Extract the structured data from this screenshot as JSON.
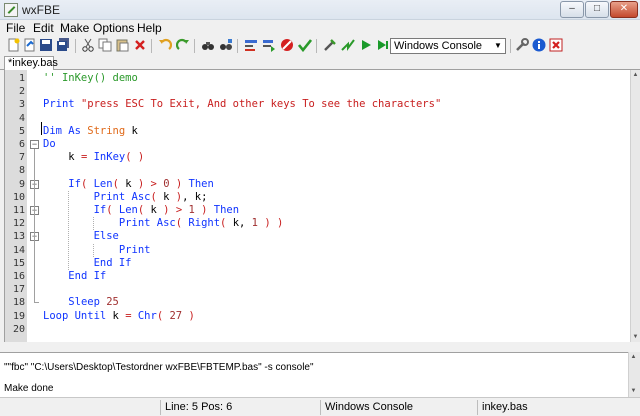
{
  "window": {
    "title": "wxFBE",
    "min_label": "–",
    "max_label": "□",
    "close_label": "✕"
  },
  "menu": [
    "File",
    "Edit",
    "Make",
    "Options",
    "Help"
  ],
  "toolbar": {
    "icons": [
      "new-file-icon",
      "open-file-icon",
      "save-icon",
      "save-all-icon",
      "cut-icon",
      "copy-icon",
      "paste-icon",
      "delete-icon",
      "undo-icon",
      "redo-icon",
      "find-icon",
      "replace-icon",
      "compile-icon",
      "compile-run-icon",
      "stop-icon",
      "check-icon",
      "build-icon",
      "quick-run-icon",
      "run-icon",
      "run-terminal-icon",
      "settings-icon",
      "info-icon",
      "close-icon"
    ],
    "target_select": "Windows Console"
  },
  "tab": {
    "label": "*inkey.bas"
  },
  "editor": {
    "lines": [
      {
        "n": "1",
        "html": "<span class='cm'>'' InKey() demo</span>"
      },
      {
        "n": "2",
        "html": ""
      },
      {
        "n": "3",
        "html": "<span class='kw'>Print</span> <span class='st'>\"press ESC To Exit, And other keys To see the characters\"</span>"
      },
      {
        "n": "4",
        "html": ""
      },
      {
        "n": "5",
        "html": "<span class='kw'>Dim As</span> <span class='ty'>String</span> <span class='id'>k</span>"
      },
      {
        "n": "6",
        "html": "<span class='kw'>Do</span>"
      },
      {
        "n": "7",
        "html": "    <span class='id'>k</span> <span class='op'>=</span> <span class='kw'>InKey</span><span class='op'>( )</span>"
      },
      {
        "n": "8",
        "html": ""
      },
      {
        "n": "9",
        "html": "    <span class='kw'>If</span><span class='op'>(</span> <span class='kw'>Len</span><span class='op'>(</span> <span class='id'>k</span> <span class='op'>) &gt;</span> <span class='nm'>0</span> <span class='op'>)</span> <span class='kw'>Then</span>"
      },
      {
        "n": "10",
        "html": "        <span class='kw'>Print Asc</span><span class='op'>(</span> <span class='id'>k</span> <span class='op'>)</span>, <span class='id'>k</span>;"
      },
      {
        "n": "11",
        "html": "        <span class='kw'>If</span><span class='op'>(</span> <span class='kw'>Len</span><span class='op'>(</span> <span class='id'>k</span> <span class='op'>) &gt;</span> <span class='nm'>1</span> <span class='op'>)</span> <span class='kw'>Then</span>"
      },
      {
        "n": "12",
        "html": "            <span class='kw'>Print Asc</span><span class='op'>(</span> <span class='kw'>Right</span><span class='op'>(</span> <span class='id'>k</span>, <span class='nm'>1</span> <span class='op'>) )</span>"
      },
      {
        "n": "13",
        "html": "        <span class='kw'>Else</span>"
      },
      {
        "n": "14",
        "html": "            <span class='kw'>Print</span>"
      },
      {
        "n": "15",
        "html": "        <span class='kw'>End If</span>"
      },
      {
        "n": "16",
        "html": "    <span class='kw'>End If</span>"
      },
      {
        "n": "17",
        "html": ""
      },
      {
        "n": "18",
        "html": "    <span class='kw'>Sleep</span> <span class='nm'>25</span>"
      },
      {
        "n": "19",
        "html": "<span class='kw'>Loop Until</span> <span class='id'>k</span> <span class='op'>=</span> <span class='kw'>Chr</span><span class='op'>(</span> <span class='nm'>27</span> <span class='op'>)</span>"
      },
      {
        "n": "20",
        "html": ""
      }
    ]
  },
  "output": {
    "command": "\"\"fbc\" \"C:\\Users\\Desktop\\Testordner wxFBE\\FBTEMP.bas\" -s console\"",
    "status": "Make done"
  },
  "statusbar": {
    "position": "Line: 5 Pos: 6",
    "target": "Windows Console",
    "file": "inkey.bas"
  }
}
